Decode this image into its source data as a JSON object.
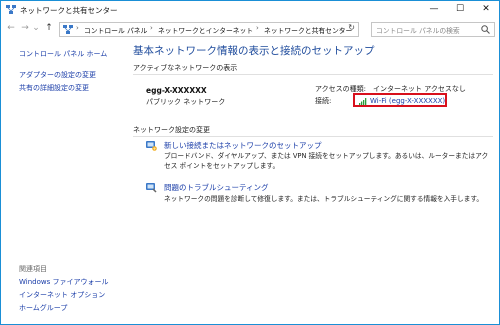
{
  "window": {
    "title": "ネットワークと共有センター",
    "buttons": [
      "—",
      "☐",
      "✕"
    ]
  },
  "toolbar": {
    "back": "←",
    "forward": "→",
    "recent": "⌄",
    "up": "↑",
    "breadcrumb": [
      "コントロール パネル",
      "ネットワークとインターネット",
      "ネットワークと共有センター"
    ],
    "separator": "›",
    "dropdown": "⌄",
    "refresh": "↻",
    "search_placeholder": "コントロール パネルの検索"
  },
  "sidebar": {
    "home": "コントロール パネル ホーム",
    "links": [
      "アダプターの設定の変更",
      "共有の詳細設定の変更"
    ],
    "related_heading": "関連項目",
    "related": [
      "Windows ファイアウォール",
      "インターネット オプション",
      "ホームグループ"
    ]
  },
  "main": {
    "title": "基本ネットワーク情報の表示と接続のセットアップ",
    "active_heading": "アクティブなネットワークの表示",
    "network_name": "egg-X-XXXXXX",
    "network_type": "パブリック ネットワーク",
    "access_label": "アクセスの種類:",
    "access_value": "インターネット アクセスなし",
    "connection_label": "接続:",
    "connection_value": "Wi-Fi (egg-X-XXXXXX)",
    "settings_heading": "ネットワーク設定の変更",
    "tasks": [
      {
        "title": "新しい接続またはネットワークのセットアップ",
        "desc": "ブロードバンド、ダイヤルアップ、または VPN 接続をセットアップします。あるいは、ルーターまたはアクセス ポイントをセットアップします。"
      },
      {
        "title": "問題のトラブルシューティング",
        "desc": "ネットワークの問題を診断して修復します。または、トラブルシューティングに関する情報を入手します。"
      }
    ]
  },
  "colors": {
    "link": "#1a3da8",
    "title": "#1e4b9c",
    "highlight": "#d8101c",
    "window_border": "#1a8fd6"
  }
}
